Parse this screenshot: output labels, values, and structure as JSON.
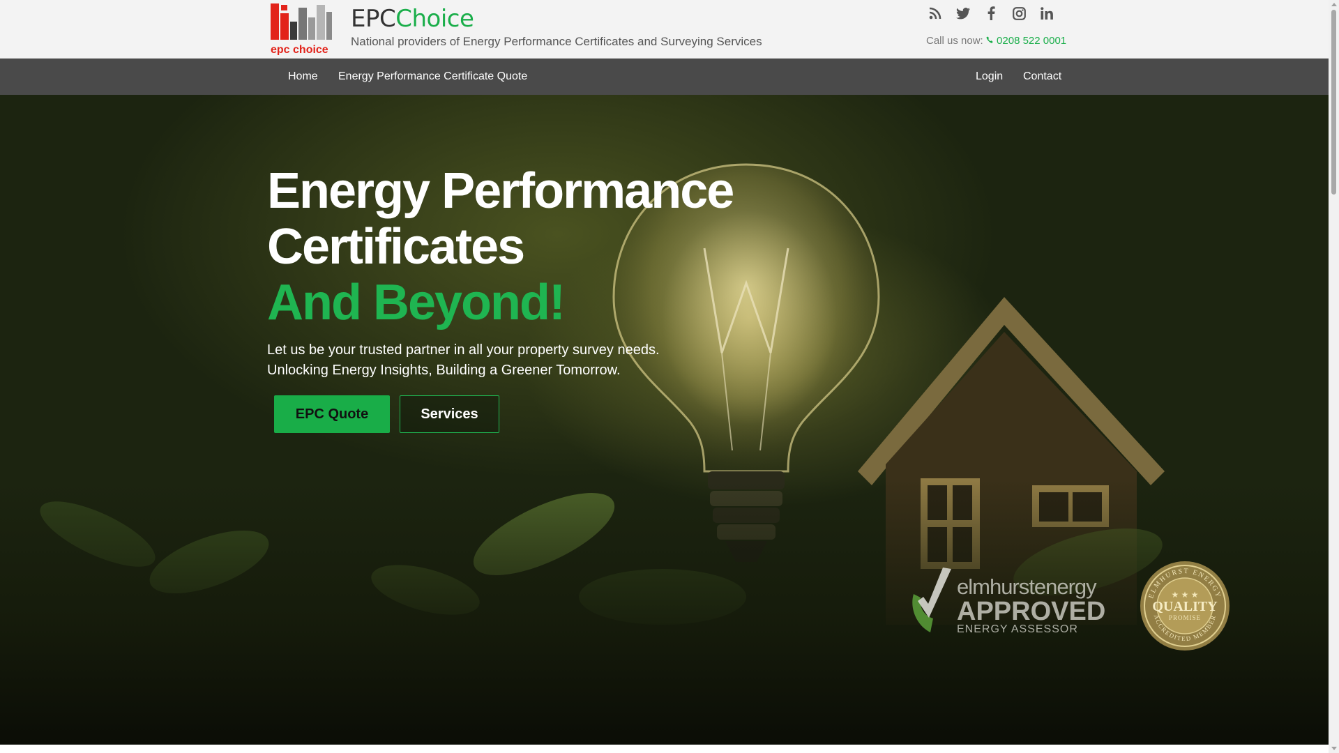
{
  "header": {
    "logo_text": "epc choice",
    "brand_part1": "EPC",
    "brand_part2": "Choice",
    "tagline": "National providers of Energy Performance Certificates and Surveying Services",
    "call_label": "Call us now:",
    "phone": "0208 522 0001",
    "social_icons": [
      "rss-icon",
      "twitter-icon",
      "facebook-icon",
      "instagram-icon",
      "linkedin-icon"
    ]
  },
  "nav": {
    "home": "Home",
    "quote": "Energy Performance Certificate Quote",
    "login": "Login",
    "contact": "Contact"
  },
  "hero": {
    "heading_line1": "Energy Performance",
    "heading_line2": "Certificates",
    "heading_accent": "And Beyond!",
    "lead_line1": "Let us be your trusted partner in all your property survey needs.",
    "lead_line2": "Unlocking Energy Insights, Building a Greener Tomorrow.",
    "btn_primary": "EPC Quote",
    "btn_secondary": "Services"
  },
  "badges": {
    "elmhurst_brand": "elmhurstenergy",
    "elmhurst_approved": "APPROVED",
    "elmhurst_assessor": "ENERGY ASSESSOR",
    "quality_main": "QUALITY",
    "quality_sub": "PROMISE",
    "quality_ring_top": "ELMHURST ENERGY",
    "quality_ring_bottom": "ACCREDITED MEMBER"
  },
  "colors": {
    "brand_green": "#1aae4a",
    "nav_bg": "#4a4a4a",
    "header_bg": "#f3f3f3"
  }
}
